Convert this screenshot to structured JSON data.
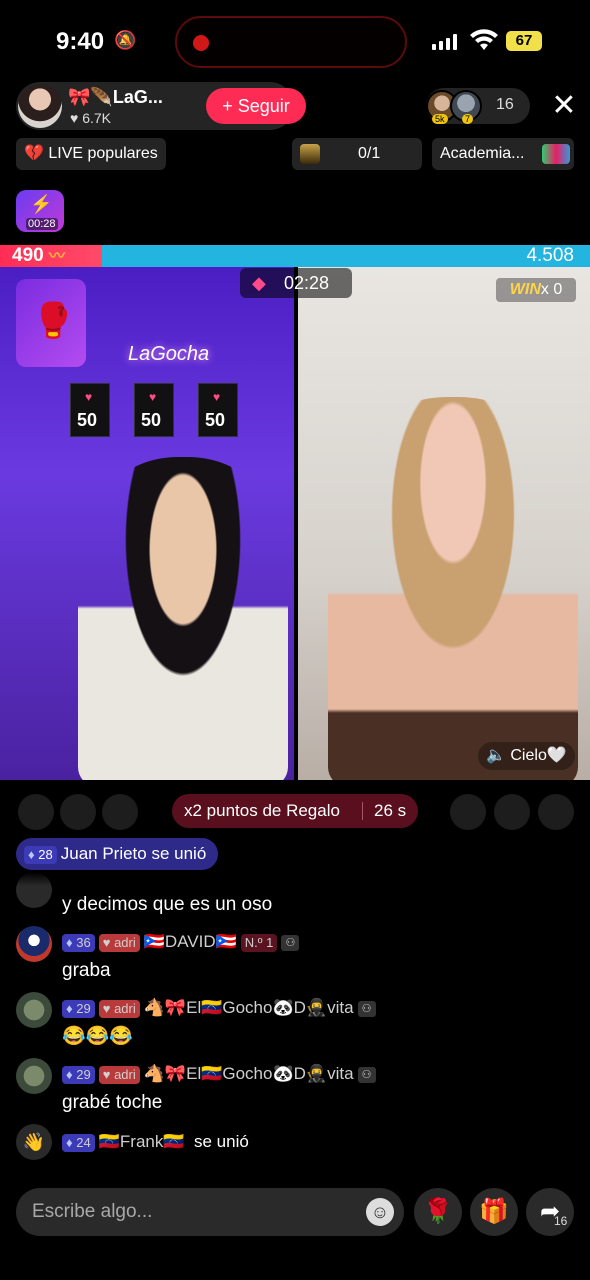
{
  "status_bar": {
    "time": "9:40",
    "battery": "67"
  },
  "host": {
    "name": "🎀🪶LaG...",
    "likes": "♥ 6.7K",
    "follow_label": "+ Seguir"
  },
  "viewers": {
    "count": "16",
    "badge1": "5k",
    "badge2": "7"
  },
  "row2": {
    "live_popular": "💔 LIVE populares",
    "gift_progress": "0/1",
    "academia": "Academia..."
  },
  "timer_badge": {
    "time": "00:28"
  },
  "battle": {
    "score_left": "490",
    "score_right": "4.508",
    "timer": "02:28",
    "win_label": "WIN",
    "win_count": "x 0",
    "opponent_label": "Cielo🤍",
    "posters": [
      "50",
      "50",
      "50"
    ],
    "neon_text": "LaGocha"
  },
  "promo": {
    "label": "x2 puntos de Regalo",
    "seconds": "26 s"
  },
  "joined_banner": {
    "level": "28",
    "text": "Juan Prieto se unió"
  },
  "chat": [
    {
      "user": "",
      "level": "",
      "badge": "",
      "text": "y decimos que es un oso"
    },
    {
      "level": "36",
      "badge": "adri",
      "user": "🇵🇷DAVID🇵🇷",
      "rank": "N.º 1",
      "text": "graba"
    },
    {
      "level": "29",
      "badge": "adri",
      "user": "🐴🎀El🇻🇪Gocho🐼D🥷vita",
      "text": "😂😂😂"
    },
    {
      "level": "29",
      "badge": "adri",
      "user": "🐴🎀El🇻🇪Gocho🐼D🥷vita",
      "text": "grabé toche"
    },
    {
      "level": "24",
      "user": "🇻🇪Frank🇻🇪",
      "suffix": "se unió"
    }
  ],
  "composer": {
    "placeholder": "Escribe algo...",
    "share_count": "16"
  },
  "colors": {
    "accent": "#fe2c55",
    "score_left": "#ff2d55",
    "score_right": "#23b4e0"
  }
}
